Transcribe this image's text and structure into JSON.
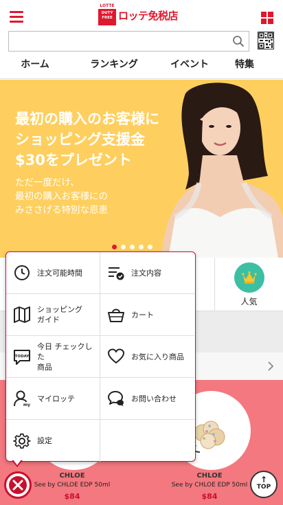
{
  "header": {
    "logo_top": "LOTTE",
    "logo_lines": [
      "DUTY",
      "FREE"
    ],
    "logo_text": "ロッテ免税店"
  },
  "search": {
    "placeholder": "",
    "value": ""
  },
  "tabs": [
    {
      "label": "ホーム",
      "active": true
    },
    {
      "label": "ランキング",
      "active": false
    },
    {
      "label": "イベント",
      "active": false
    },
    {
      "label": "特集",
      "active": false
    }
  ],
  "banner": {
    "headline_lines": [
      "最初の購入のお客様に",
      "ショッピング支援金",
      "$30をプレゼント"
    ],
    "sub_lines": [
      "ただ一度だけ、",
      "最初の購入お客様にの",
      "みささげる特別な恩恵"
    ],
    "dots": 5,
    "active_dot": 0,
    "background": "#fecf5f"
  },
  "category": {
    "label": "人気"
  },
  "products": [
    {
      "brand": "CHLOE",
      "desc": "See by CHLOE EDP 50ml",
      "price": "$84"
    },
    {
      "brand": "CHLOE",
      "desc": "See by CHLOE EDP 50ml",
      "price": "$84"
    }
  ],
  "top_button": {
    "label": "TOP",
    "arrow": "↑"
  },
  "menu": {
    "items": [
      {
        "label": "注文可能時間",
        "icon": "clock-icon"
      },
      {
        "label": "注文内容",
        "icon": "order-list-icon"
      },
      {
        "label": "ショッピング\nガイド",
        "icon": "map-icon"
      },
      {
        "label": "カート",
        "icon": "basket-icon"
      },
      {
        "label": "今日 チェックした\n商品",
        "icon": "today-icon"
      },
      {
        "label": "お気に入り商品",
        "icon": "heart-icon"
      },
      {
        "label": "マイロッテ",
        "icon": "user-icon"
      },
      {
        "label": "お問い合わせ",
        "icon": "chat-icon"
      },
      {
        "label": "設定",
        "icon": "gear-icon"
      }
    ]
  },
  "colors": {
    "brand": "#e0182d",
    "popup_border": "#c8102e",
    "product_bg": "#f4787f",
    "category_circle": "#3dbfa4"
  }
}
